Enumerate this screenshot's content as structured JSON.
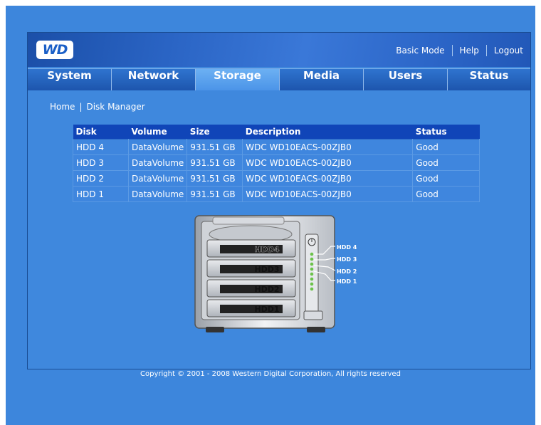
{
  "header": {
    "logo_text": "WD",
    "links": [
      "Basic Mode",
      "Help",
      "Logout"
    ]
  },
  "tabs": [
    {
      "label": "System",
      "active": false
    },
    {
      "label": "Network",
      "active": false
    },
    {
      "label": "Storage",
      "active": true
    },
    {
      "label": "Media",
      "active": false
    },
    {
      "label": "Users",
      "active": false
    },
    {
      "label": "Status",
      "active": false
    }
  ],
  "breadcrumb": {
    "home": "Home",
    "separator": "|",
    "current": "Disk Manager"
  },
  "table": {
    "headers": [
      "Disk",
      "Volume",
      "Size",
      "Description",
      "Status"
    ],
    "rows": [
      [
        "HDD 4",
        "DataVolume",
        "931.51 GB",
        "WDC WD10EACS-00ZJB0",
        "Good"
      ],
      [
        "HDD 3",
        "DataVolume",
        "931.51 GB",
        "WDC WD10EACS-00ZJB0",
        "Good"
      ],
      [
        "HDD 2",
        "DataVolume",
        "931.51 GB",
        "WDC WD10EACS-00ZJB0",
        "Good"
      ],
      [
        "HDD 1",
        "DataVolume",
        "931.51 GB",
        "WDC WD10EACS-00ZJB0",
        "Good"
      ]
    ]
  },
  "illustration": {
    "bay_labels": [
      "HDD4",
      "HDD3",
      "HDD2",
      "HDD1"
    ],
    "callouts": [
      "HDD 4",
      "HDD 3",
      "HDD 2",
      "HDD 1"
    ]
  },
  "footer": {
    "copyright": "Copyright © 2001 - 2008 Western Digital Corporation, All rights reserved"
  },
  "colors": {
    "page_bg": "#3d86dc",
    "tab_active": "#5aa3ee",
    "table_header": "#1045b8"
  }
}
